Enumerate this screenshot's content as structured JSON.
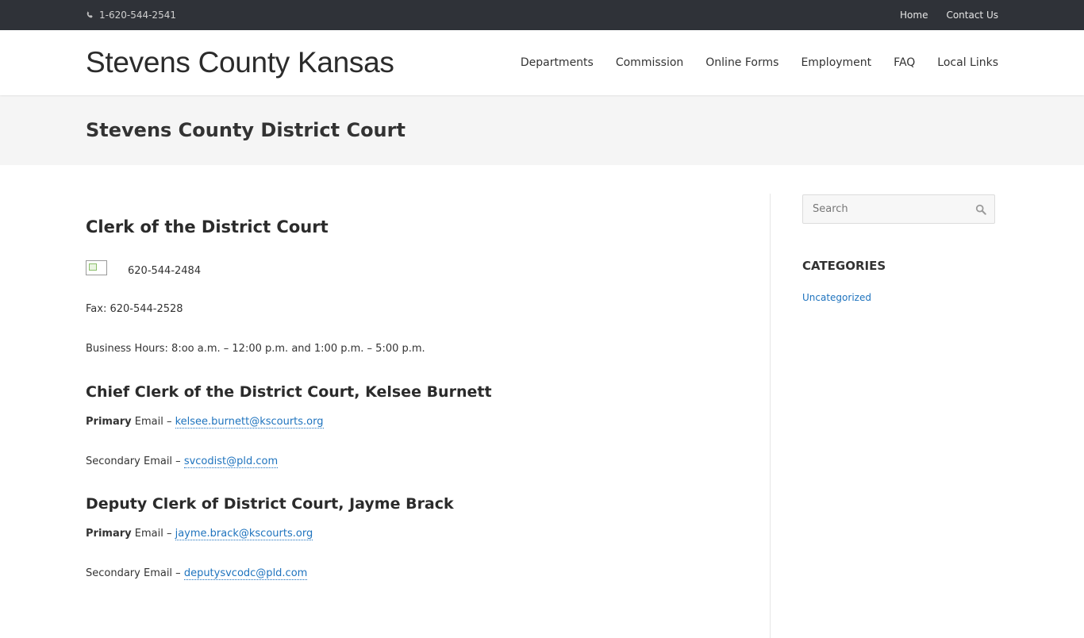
{
  "topbar": {
    "phone": "1-620-544-2541",
    "links": [
      "Home",
      "Contact Us"
    ]
  },
  "header": {
    "site_title": "Stevens County Kansas",
    "nav": [
      "Departments",
      "Commission",
      "Online Forms",
      "Employment",
      "FAQ",
      "Local Links"
    ]
  },
  "page": {
    "title": "Stevens County District Court"
  },
  "main": {
    "section1": {
      "heading": "Clerk of the District Court",
      "phone": "620-544-2484",
      "fax": "Fax: 620-544-2528",
      "hours": "Business Hours: 8:oo a.m. – 12:00 p.m. and 1:00 p.m. – 5:00 p.m."
    },
    "section2": {
      "heading": "Chief Clerk of the District Court, Kelsee Burnett",
      "primary_bold": "Primary",
      "primary_label": " Email – ",
      "primary_email": "kelsee.burnett@kscourts.org",
      "secondary_label": "Secondary Email – ",
      "secondary_email": "svcodist@pld.com"
    },
    "section3": {
      "heading": "Deputy Clerk of District Court, Jayme Brack",
      "primary_bold": "Primary",
      "primary_label": " Email – ",
      "primary_email": "jayme.brack@kscourts.org",
      "secondary_label": "Secondary Email – ",
      "secondary_email": "deputysvcodc@pld.com"
    }
  },
  "sidebar": {
    "search_placeholder": "Search",
    "categories_title": "CATEGORIES",
    "categories": [
      "Uncategorized"
    ]
  },
  "colors": {
    "topbar_bg": "#2f3238",
    "link": "#1e73be",
    "pagehead_bg": "#f5f5f5"
  }
}
